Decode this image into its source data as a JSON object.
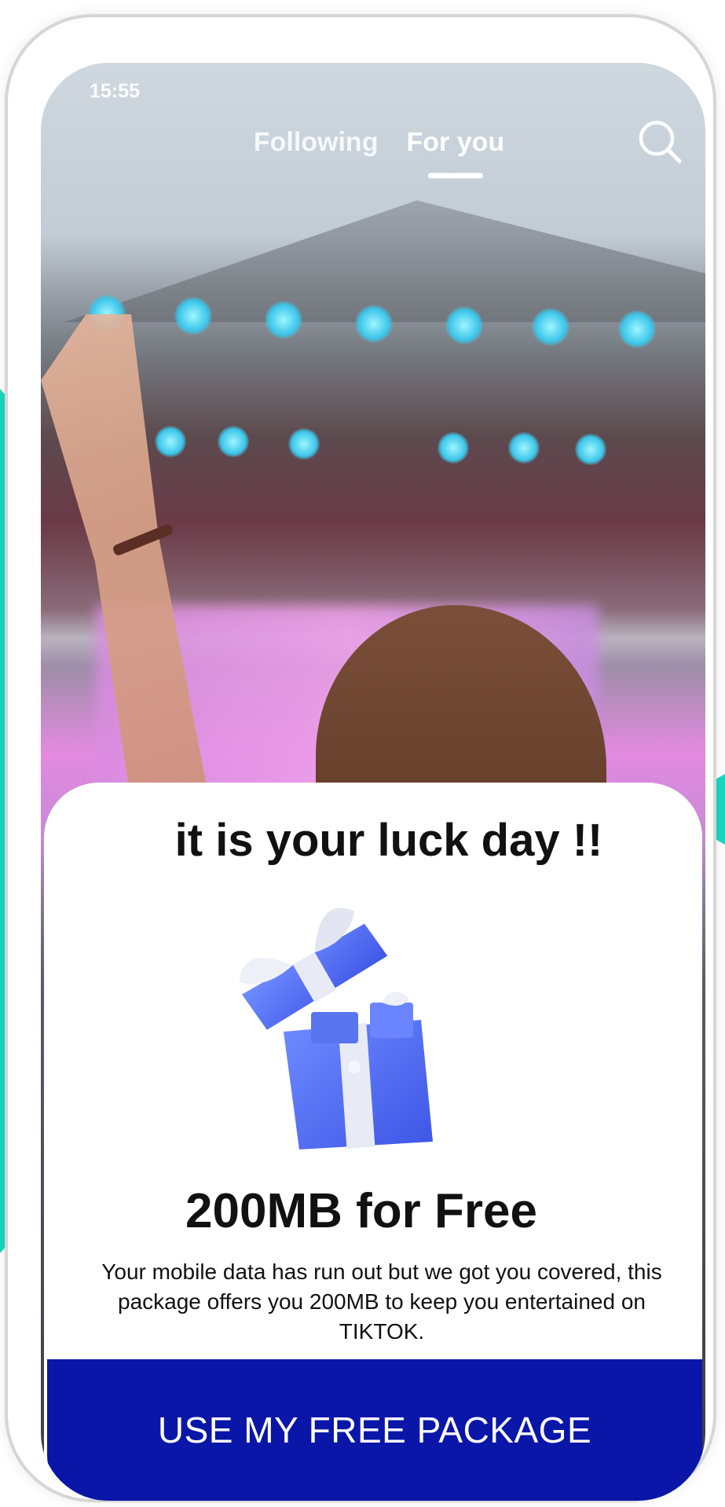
{
  "status_bar": {
    "time": "15:55"
  },
  "top_tabs": [
    {
      "label": "Following",
      "active": false
    },
    {
      "label": "For you",
      "active": true
    }
  ],
  "icons": {
    "search": "search-icon",
    "gift": "gift-box-icon"
  },
  "popup": {
    "headline": "it is your luck day !!",
    "offer_title": "200MB for Free",
    "description": "Your mobile data has run out but we got you covered, this package offers you 200MB to keep you entertained on TIKTOK.",
    "cta_label": "USE MY FREE PACKAGE"
  },
  "colors": {
    "accent": "#19d7c0",
    "cta_background": "#0a16a8",
    "gift_blue": "#4f6ef5"
  }
}
